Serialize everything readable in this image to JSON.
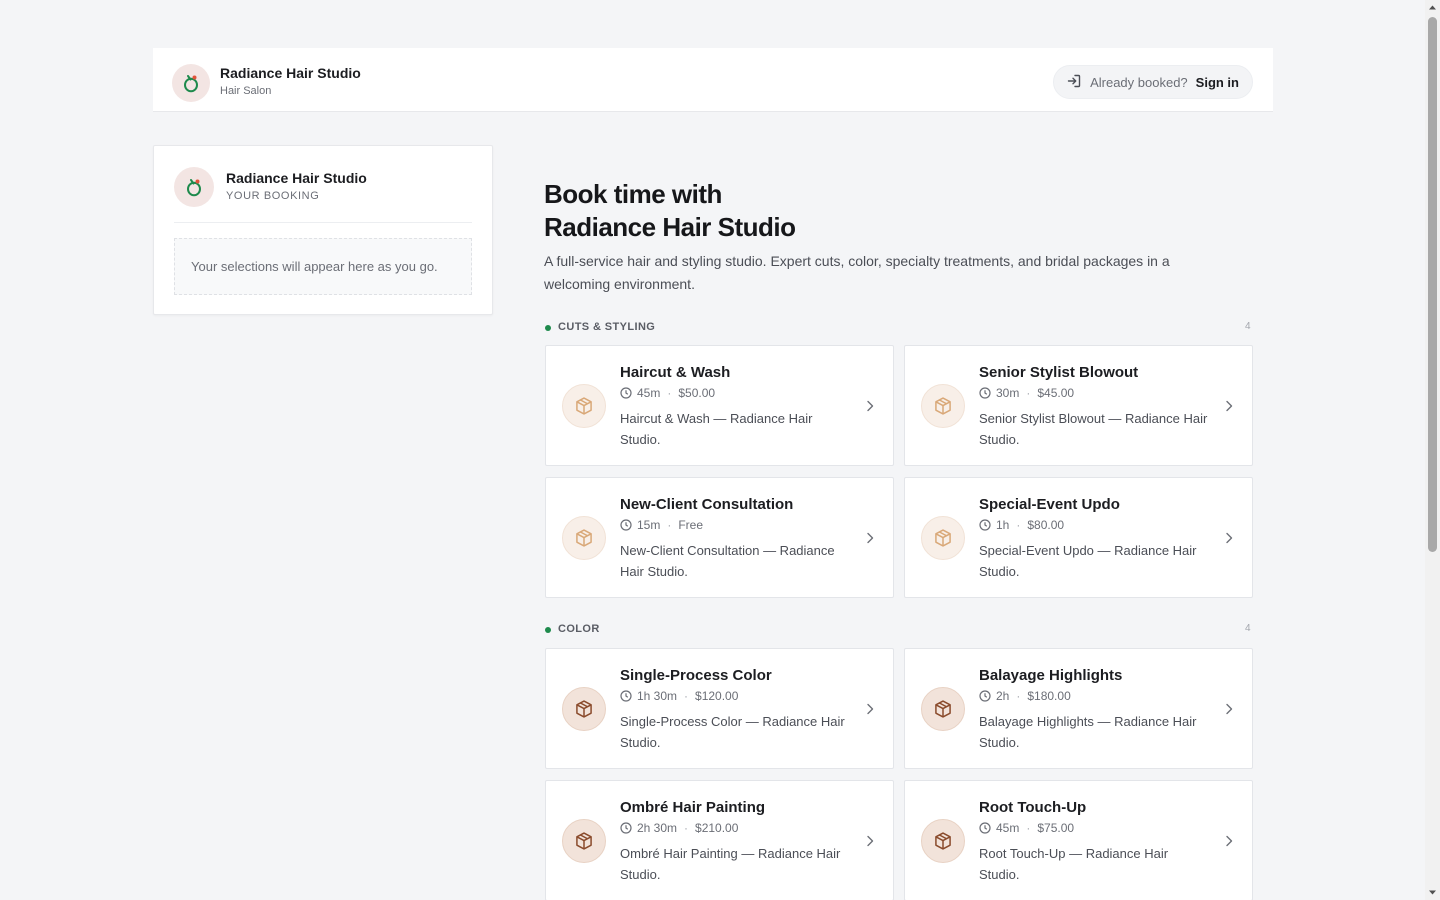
{
  "header": {
    "brand_name": "Radiance Hair Studio",
    "brand_sub": "Hair Salon",
    "signin_prompt": "Already booked?",
    "signin_label": "Sign in"
  },
  "booking": {
    "name": "Radiance Hair Studio",
    "sub": "YOUR BOOKING",
    "empty_text": "Your selections will appear here as you go."
  },
  "main": {
    "title_line1": "Book time with",
    "title_line2": "Radiance Hair Studio",
    "description": "A full-service hair and styling studio. Expert cuts, color, specialty treatments, and bridal packages in a welcoming environment."
  },
  "sections": [
    {
      "label": "CUTS & STYLING",
      "count": "4",
      "services": [
        {
          "name": "Haircut & Wash",
          "duration": "45m",
          "price": "$50.00",
          "description": "Haircut & Wash — Radiance Hair Studio."
        },
        {
          "name": "Senior Stylist Blowout",
          "duration": "30m",
          "price": "$45.00",
          "description": "Senior Stylist Blowout — Radiance Hair Studio."
        },
        {
          "name": "New-Client Consultation",
          "duration": "15m",
          "price": "Free",
          "description": "New-Client Consultation — Radiance Hair Studio."
        },
        {
          "name": "Special-Event Updo",
          "duration": "1h",
          "price": "$80.00",
          "description": "Special-Event Updo — Radiance Hair Studio."
        }
      ]
    },
    {
      "label": "COLOR",
      "count": "4",
      "services": [
        {
          "name": "Single-Process Color",
          "duration": "1h 30m",
          "price": "$120.00",
          "description": "Single-Process Color — Radiance Hair Studio."
        },
        {
          "name": "Balayage Highlights",
          "duration": "2h",
          "price": "$180.00",
          "description": "Balayage Highlights — Radiance Hair Studio."
        },
        {
          "name": "Ombré Hair Painting",
          "duration": "2h 30m",
          "price": "$210.00",
          "description": "Ombré Hair Painting — Radiance Hair Studio."
        },
        {
          "name": "Root Touch-Up",
          "duration": "45m",
          "price": "$75.00",
          "description": "Root Touch-Up — Radiance Hair Studio."
        }
      ]
    }
  ],
  "colors": {
    "accent_green": "#1e8a4c",
    "brand_pink": "#f3e5e3",
    "icon_light": "#d9a878",
    "icon_dark": "#8a4b2c"
  },
  "icons": {
    "logo": "leaf-ring-logo-icon",
    "signin": "sign-in-icon",
    "service": "box-icon",
    "duration": "clock-icon",
    "open": "chevron-right-icon"
  }
}
